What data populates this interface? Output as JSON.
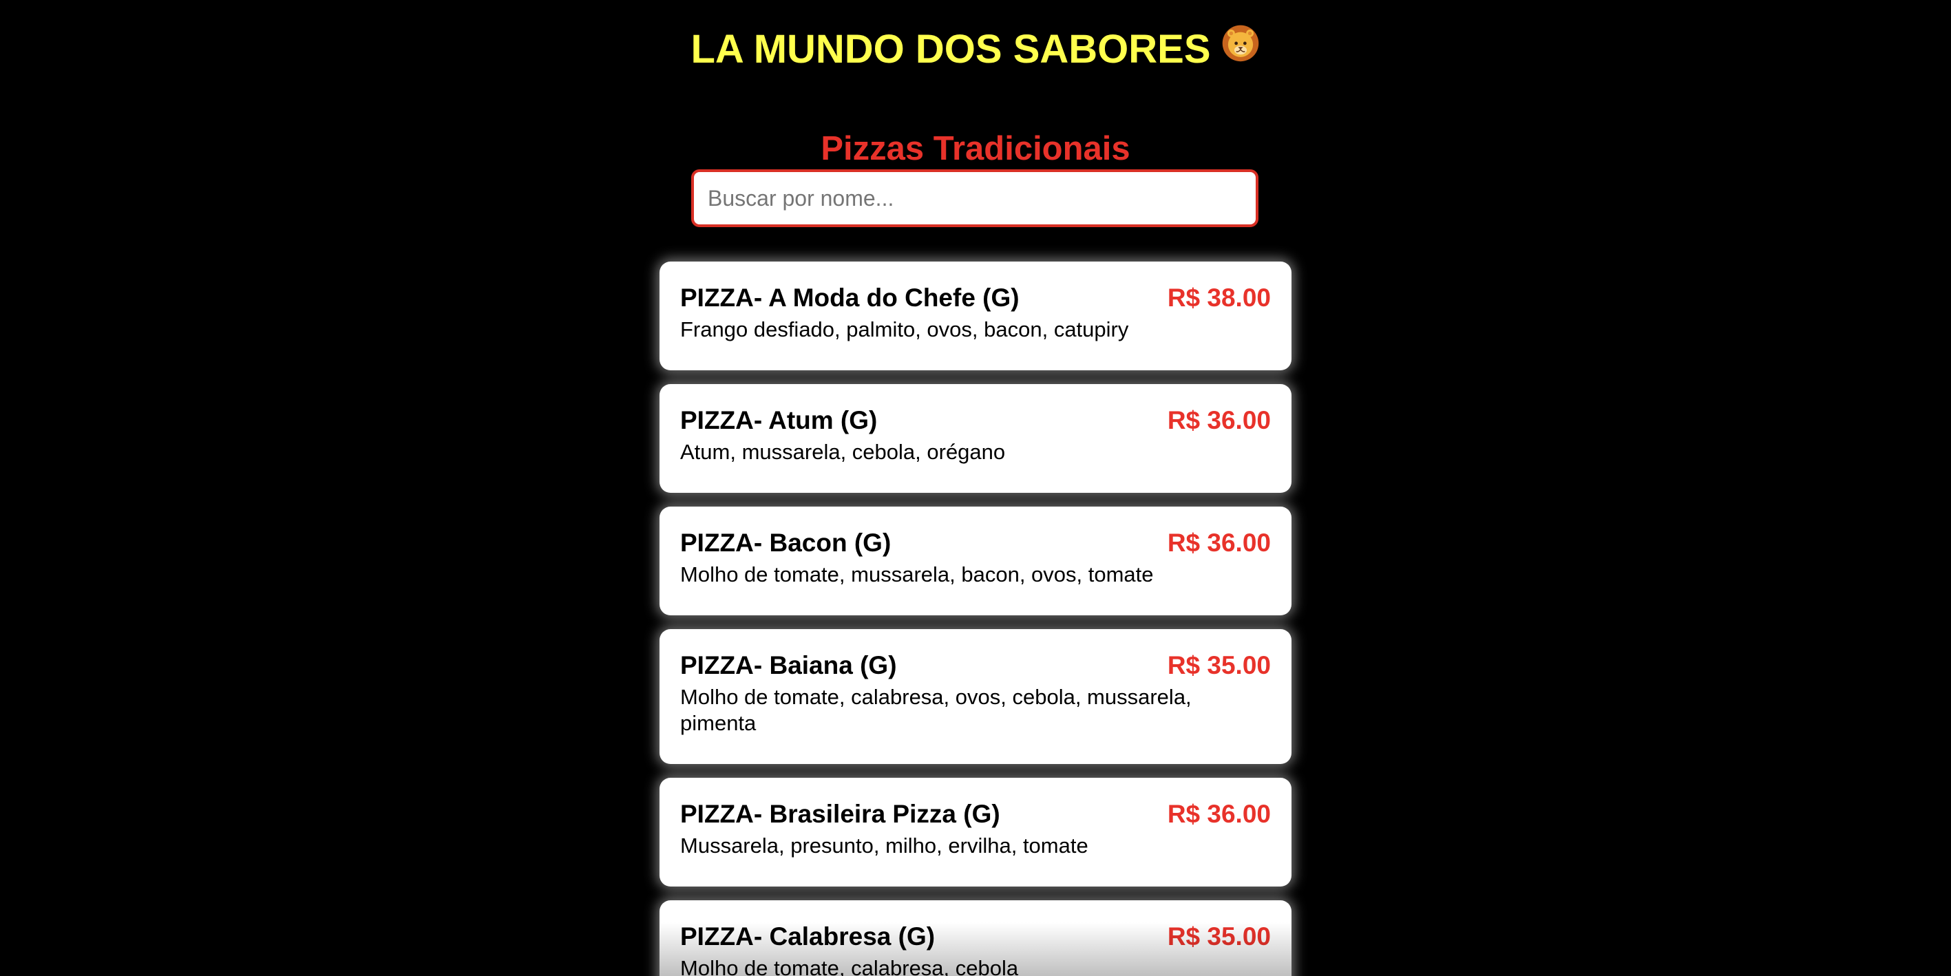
{
  "header": {
    "title": "LA MUNDO DOS SABORES",
    "logo_icon": "lion-face-icon"
  },
  "section": {
    "title": "Pizzas Tradicionais"
  },
  "search": {
    "placeholder": "Buscar por nome...",
    "value": ""
  },
  "colors": {
    "background": "#000000",
    "title": "#ffff4d",
    "accent": "#e8322a",
    "card": "#ffffff"
  },
  "menu": {
    "items": [
      {
        "name": "PIZZA- A Moda do Chefe (G)",
        "price": "R$ 38.00",
        "description": "Frango desfiado, palmito, ovos, bacon, catupiry"
      },
      {
        "name": "PIZZA- Atum (G)",
        "price": "R$ 36.00",
        "description": "Atum, mussarela, cebola, orégano"
      },
      {
        "name": "PIZZA- Bacon (G)",
        "price": "R$ 36.00",
        "description": "Molho de tomate, mussarela, bacon, ovos, tomate"
      },
      {
        "name": "PIZZA- Baiana (G)",
        "price": "R$ 35.00",
        "description": "Molho de tomate, calabresa, ovos, cebola, mussarela, pimenta"
      },
      {
        "name": "PIZZA- Brasileira Pizza (G)",
        "price": "R$ 36.00",
        "description": "Mussarela, presunto, milho, ervilha, tomate"
      },
      {
        "name": "PIZZA- Calabresa (G)",
        "price": "R$ 35.00",
        "description": "Molho de tomate, calabresa, cebola"
      }
    ]
  }
}
